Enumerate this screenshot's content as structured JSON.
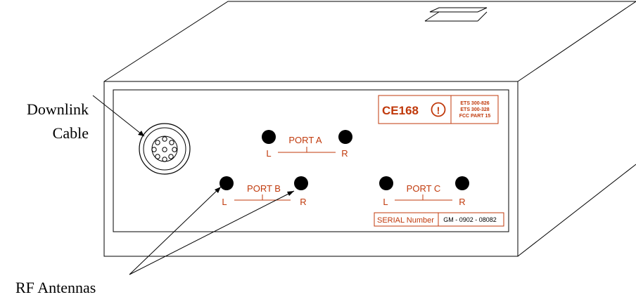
{
  "annotations": {
    "downlink_cable_line1": "Downlink",
    "downlink_cable_line2": "Cable",
    "rf_antennas": "RF  Antennas"
  },
  "ports": [
    {
      "id": "a",
      "label": "PORT A",
      "left": "L",
      "right": "R"
    },
    {
      "id": "b",
      "label": "PORT B",
      "left": "L",
      "right": "R"
    },
    {
      "id": "c",
      "label": "PORT C",
      "left": "L",
      "right": "R"
    }
  ],
  "certification": {
    "mark": "CE168",
    "alert_symbol": "!",
    "standards": [
      "ETS 300-826",
      "ETS 300-328",
      "FCC PART 15"
    ]
  },
  "serial": {
    "label": "SERIAL Number",
    "value": "GM - 0902 - 08082"
  },
  "colors": {
    "outline": "#000000",
    "label_accent": "#c0390b",
    "background": "#ffffff"
  }
}
